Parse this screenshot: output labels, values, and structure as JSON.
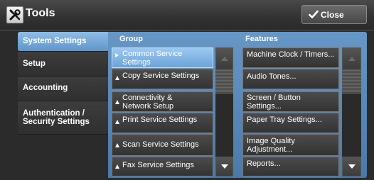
{
  "window": {
    "title": "Tools",
    "close_label": "Close"
  },
  "nav": {
    "items": [
      {
        "label": "System Settings",
        "active": true
      },
      {
        "label": "Setup",
        "active": false
      },
      {
        "label": "Accounting",
        "active": false
      },
      {
        "label_line1": "Authentication /",
        "label_line2": "Security Settings",
        "active": false
      }
    ]
  },
  "group": {
    "header": "Group",
    "items": [
      {
        "line1": "Common Service",
        "line2": "Settings",
        "selected": true,
        "icon": "triangle-right-icon"
      },
      {
        "line1": "Copy Service Settings",
        "line2": "",
        "selected": false,
        "icon": "triangle-up-icon"
      },
      {
        "line1": "Connectivity &",
        "line2": "Network Setup",
        "selected": false,
        "icon": "triangle-up-icon"
      },
      {
        "line1": "Print Service Settings",
        "line2": "",
        "selected": false,
        "icon": "triangle-up-icon"
      },
      {
        "line1": "Scan Service Settings",
        "line2": "",
        "selected": false,
        "icon": "triangle-up-icon"
      },
      {
        "line1": "Fax Service Settings",
        "line2": "",
        "selected": false,
        "icon": "triangle-up-icon"
      }
    ]
  },
  "features": {
    "header": "Features",
    "items": [
      {
        "line1": "Machine Clock / Timers...",
        "line2": ""
      },
      {
        "line1": "Audio Tones...",
        "line2": ""
      },
      {
        "line1": "Screen / Button",
        "line2": "Settings..."
      },
      {
        "line1": "Paper Tray Settings...",
        "line2": ""
      },
      {
        "line1": "Image Quality",
        "line2": "Adjustment..."
      },
      {
        "line1": "Reports...",
        "line2": ""
      }
    ]
  },
  "colors": {
    "accent": "#5f95c9",
    "panel": "#4a79aa",
    "button": "#3d3d3d"
  }
}
